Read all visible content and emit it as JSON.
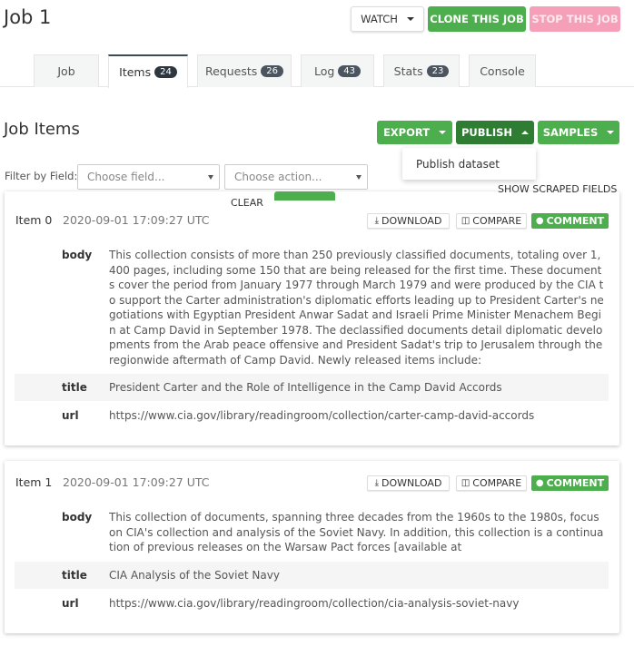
{
  "header": {
    "title": "Job 1",
    "watch_label": "WATCH",
    "clone_label": "CLONE THIS JOB",
    "stop_label": "STOP THIS JOB"
  },
  "tabs": [
    {
      "label": "Job",
      "count": ""
    },
    {
      "label": "Items",
      "count": "24"
    },
    {
      "label": "Requests",
      "count": "26"
    },
    {
      "label": "Log",
      "count": "43"
    },
    {
      "label": "Stats",
      "count": "23"
    },
    {
      "label": "Console",
      "count": ""
    }
  ],
  "items_section": {
    "title": "Job Items",
    "export_label": "EXPORT",
    "publish_label": "PUBLISH",
    "samples_label": "SAMPLES",
    "publish_menu": [
      "Publish dataset"
    ],
    "filter_label": "Filter by Field:",
    "field_placeholder": "Choose field...",
    "action_placeholder": "Choose action...",
    "clear_label": "CLEAR",
    "show_scraped_label": "SHOW SCRAPED FIELDS"
  },
  "item_actions": {
    "download": "DOWNLOAD",
    "compare": "COMPARE",
    "comment": "COMMENT"
  },
  "items": [
    {
      "title": "Item 0",
      "date": "2020-09-01 17:09:27 UTC",
      "fields": [
        {
          "name": "body",
          "value": "This collection consists of more than 250 previously classified documents, totaling over 1,400 pages, including some 150 that are being released for the first time.  These documents cover the period from January 1977 through March 1979 and were produced by the CIA to support the Carter administration's diplomatic efforts leading up to President Carter's negotiations with Egyptian President Anwar Sadat and Israeli Prime Minister Menachem Begin at Camp David in September 1978.  The declassified documents detail diplomatic developments from the Arab peace offensive and President Sadat's trip to Jerusalem through the regionwide aftermath of Camp David. Newly released items include:"
        },
        {
          "name": "title",
          "value": "President Carter and the Role of Intelligence in the Camp David Accords"
        },
        {
          "name": "url",
          "value": "https://www.cia.gov/library/readingroom/collection/carter-camp-david-accords"
        }
      ]
    },
    {
      "title": "Item 1",
      "date": "2020-09-01 17:09:27 UTC",
      "fields": [
        {
          "name": "body",
          "value": "This collection of documents, spanning three decades from the 1960s to the 1980s, focus on CIA's collection and analysis of the Soviet Navy.  In addition, this collection is a continuation of previous releases on the Warsaw Pact forces [available at"
        },
        {
          "name": "title",
          "value": "CIA Analysis of the Soviet Navy"
        },
        {
          "name": "url",
          "value": "https://www.cia.gov/library/readingroom/collection/cia-analysis-soviet-navy"
        }
      ]
    }
  ]
}
